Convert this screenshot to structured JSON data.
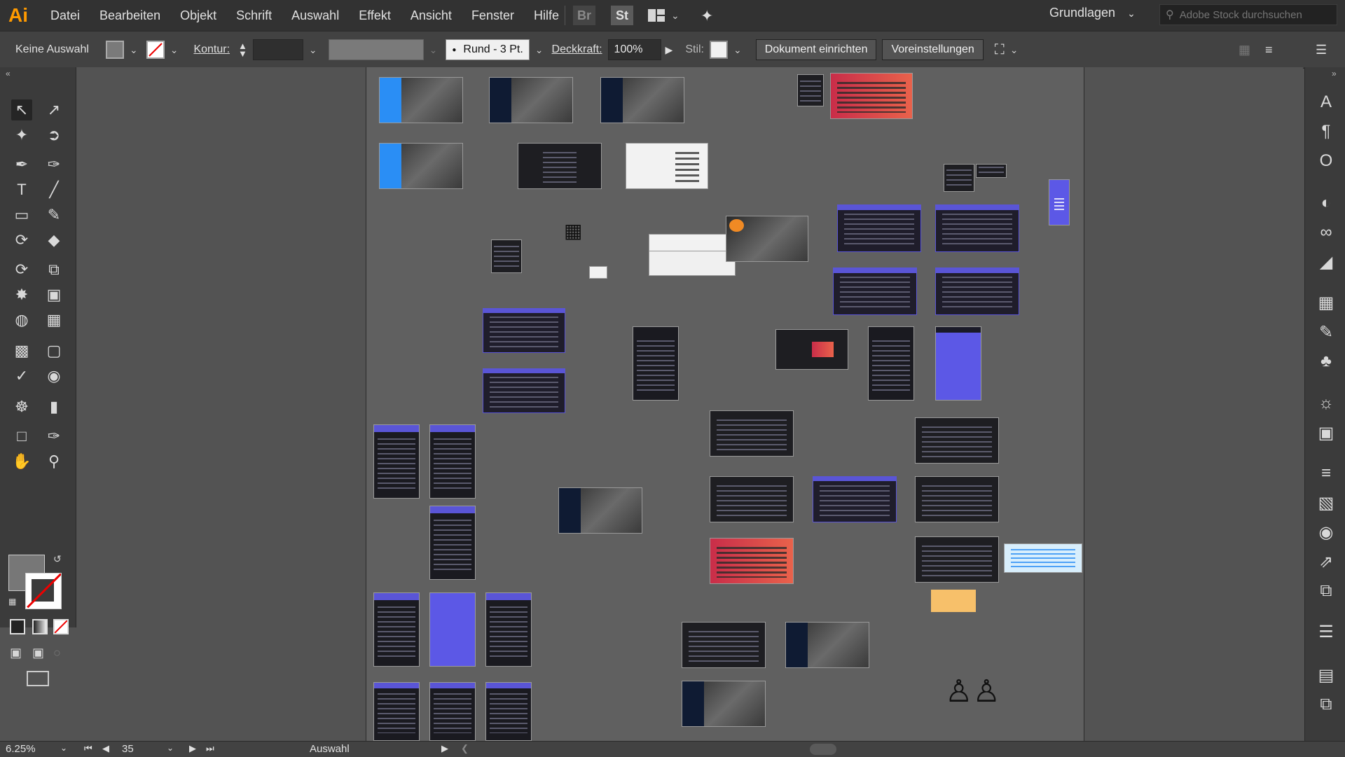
{
  "app": {
    "logo": "Ai"
  },
  "menu": [
    "Datei",
    "Bearbeiten",
    "Objekt",
    "Schrift",
    "Auswahl",
    "Effekt",
    "Ansicht",
    "Fenster",
    "Hilfe"
  ],
  "app_switch": {
    "bridge": "Br",
    "stock": "St"
  },
  "workspace": {
    "label": "Grundlagen"
  },
  "stock_search": {
    "placeholder": "Adobe Stock durchsuchen"
  },
  "control": {
    "selection": "Keine Auswahl",
    "stroke_label": "Kontur:",
    "brush": "Rund - 3 Pt.",
    "opacity_label": "Deckkraft:",
    "opacity_value": "100%",
    "style_label": "Stil:",
    "doc_setup": "Dokument einrichten",
    "preferences": "Voreinstellungen"
  },
  "status": {
    "zoom": "6.25%",
    "artboard": "35",
    "mode": "Auswahl"
  },
  "colors": {
    "accent_orange": "#ff9a00",
    "ui_dark": "#323232",
    "panel": "#3b3b3b",
    "canvas": "#535353",
    "artboard_bg": "#606060",
    "brand_purple": "#5a55d6",
    "brand_blue": "#2a8ef5",
    "gradient_red": "#c92d49"
  },
  "icons": {
    "tools": [
      "selection-tool-icon",
      "direct-selection-tool-icon",
      "magic-wand-icon",
      "lasso-icon",
      "pen-tool-icon",
      "curvature-tool-icon",
      "type-tool-icon",
      "line-tool-icon",
      "rectangle-tool-icon",
      "paintbrush-icon",
      "shaper-tool-icon",
      "eraser-icon",
      "rotate-tool-icon",
      "scale-tool-icon",
      "warp-tool-icon",
      "free-transform-icon",
      "shape-builder-icon",
      "perspective-grid-icon",
      "mesh-tool-icon",
      "gradient-tool-icon",
      "eyedropper-icon",
      "blend-tool-icon",
      "symbol-sprayer-icon",
      "graph-tool-icon",
      "artboard-tool-icon",
      "slice-tool-icon",
      "hand-tool-icon",
      "zoom-tool-icon"
    ],
    "right_panel": [
      "character-icon",
      "paragraph-icon",
      "opentype-icon",
      "color-guide-icon",
      "creative-cloud-libraries-icon",
      "gradient-panel-icon",
      "swatches-icon",
      "brushes-icon",
      "symbols-icon",
      "appearance-icon",
      "graphic-styles-icon",
      "stroke-icon",
      "transparency-icon",
      "color-icon",
      "export-icon",
      "artboards-icon",
      "layers-icon",
      "align-icon",
      "pathfinder-icon"
    ]
  }
}
